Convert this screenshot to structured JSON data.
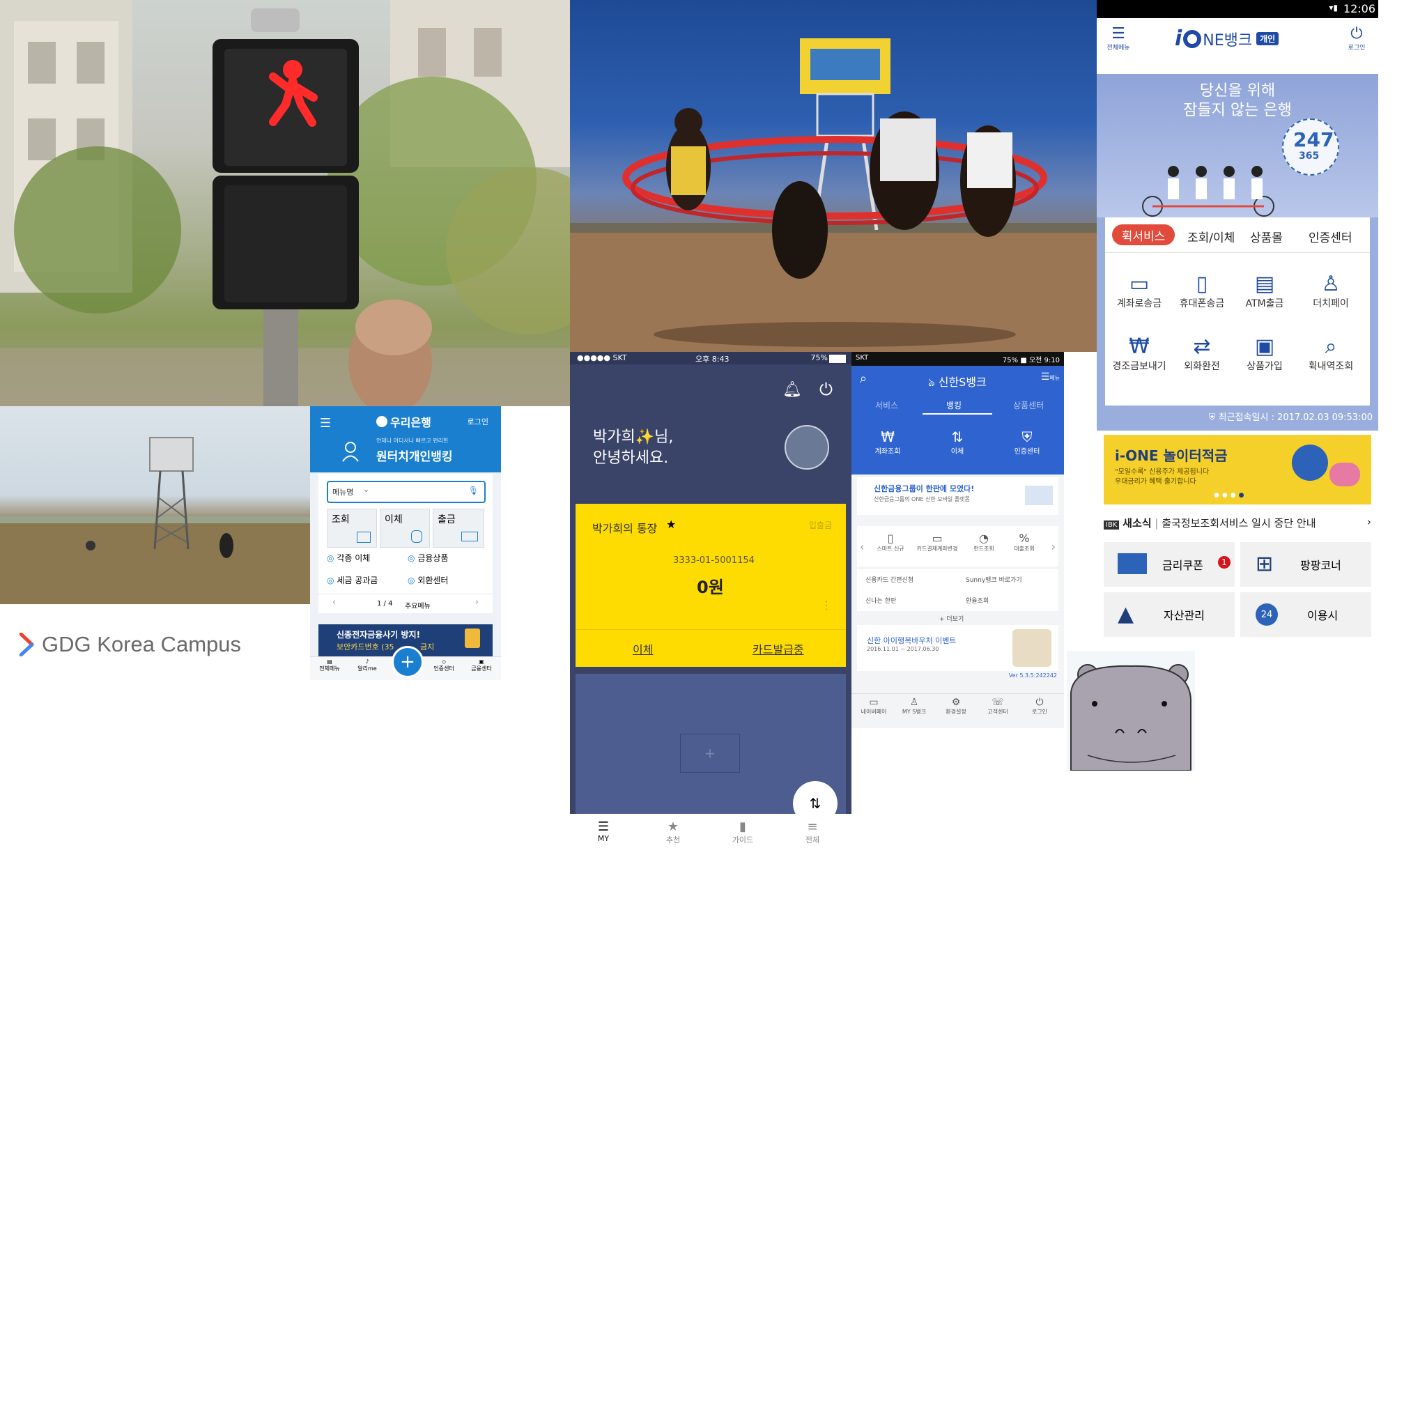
{
  "logo": {
    "text": "GDG Korea Campus",
    "colors": [
      "#ea4335",
      "#4285f4",
      "#fbbc05",
      "#34a853"
    ]
  },
  "woori": {
    "brand": "우리은행",
    "login": "로그인",
    "tagline": "언제나 어디서나 빠르고 편리한",
    "title": "원터치개인뱅킹",
    "menu_dropdown": "메뉴명",
    "quick": [
      "조회",
      "이체",
      "출금"
    ],
    "menu_items": [
      "각종 이체",
      "금융상품",
      "세금 공과금",
      "외환센터"
    ],
    "pager": "1 / 4",
    "pager_label": "주요메뉴",
    "banner_title": "신종전자금융사기 방지!",
    "banner_sub": "보안카드번호 (35",
    "banner_tail": "금지",
    "bottom_nav": [
      "전체메뉴",
      "알리me",
      "인증센터",
      "금융센터"
    ],
    "accent": "#1b7fd0"
  },
  "kakao": {
    "carrier": "●●●●● SKT",
    "time": "오후 8:43",
    "battery": "75%",
    "greeting_name": "박가희",
    "greeting_suffix": "님,",
    "greeting_line2": "안녕하세요.",
    "account_title": "박가희의 통장",
    "account_action": "입출금",
    "account_number": "3333-01-5001154",
    "balance": "0원",
    "transfer": "이체",
    "card_issue": "카드발급중",
    "tabs": [
      "MY",
      "추천",
      "가이드",
      "전체"
    ],
    "card_color": "#fedc01"
  },
  "shinhan": {
    "status_left": "SKT",
    "status_right": "75% ■ 오전 9:10",
    "brand": "신한S뱅크",
    "menu": "메뉴",
    "tabs": [
      "서비스",
      "뱅킹",
      "상품센터"
    ],
    "quick": [
      "계좌조회",
      "이체",
      "인증센터"
    ],
    "banner_title": "신한금융그룹이 한판에 모였다!",
    "banner_sub": "신한금융그룹의 ONE 신한 모바일 플랫폼",
    "icons": [
      "스마트 신규",
      "카드결제계좌변경",
      "펀드조회",
      "대출조회"
    ],
    "links": [
      "신용카드 간편신청",
      "Sunny뱅크 바로가기",
      "신나는 한판",
      "환율조회"
    ],
    "more": "+ 더보기",
    "event_title": "신한 아이행복바우처 이벤트",
    "event_date": "2016.11.01 ~ 2017.06.30",
    "version": "Ver 5.3.5:242242",
    "bottom_nav": [
      "네이버페이",
      "MY S뱅크",
      "환경설정",
      "고객센터",
      "로그인"
    ],
    "accent": "#2f63cf"
  },
  "ione": {
    "time": "12:06",
    "menu_label": "전체메뉴",
    "logo_i": "i",
    "logo_rest": "NE뱅크",
    "badge": "개인",
    "logout": "로그인",
    "headline1": "당신을 위해",
    "headline2": "잠들지 않는 은행",
    "badge247": "247",
    "badge365": "365",
    "tabs": [
      "휙서비스",
      "조회/이체",
      "상품몰",
      "인증센터"
    ],
    "services": [
      "계좌로송금",
      "휴대폰송금",
      "ATM출금",
      "더치페이",
      "경조금보내기",
      "외화환전",
      "상품가입",
      "휙내역조회"
    ],
    "last_login": "최근접속일시 : 2017.02.03 09:53:00",
    "promo_title": "i-ONE 놀이터적금",
    "promo_sub1": "\"모일수록\" 신용주가 제공됩니다",
    "promo_sub2": "우대금리가 혜택 출기합니다",
    "news_label": "새소식",
    "news_text": "출국정보조회서비스 일시 중단 안내",
    "tiles": [
      "금리쿠폰",
      "팡팡코너",
      "자산관리",
      "이용시"
    ],
    "coupon_count": "1",
    "tile_24": "24",
    "accent": "#e24b3b"
  }
}
